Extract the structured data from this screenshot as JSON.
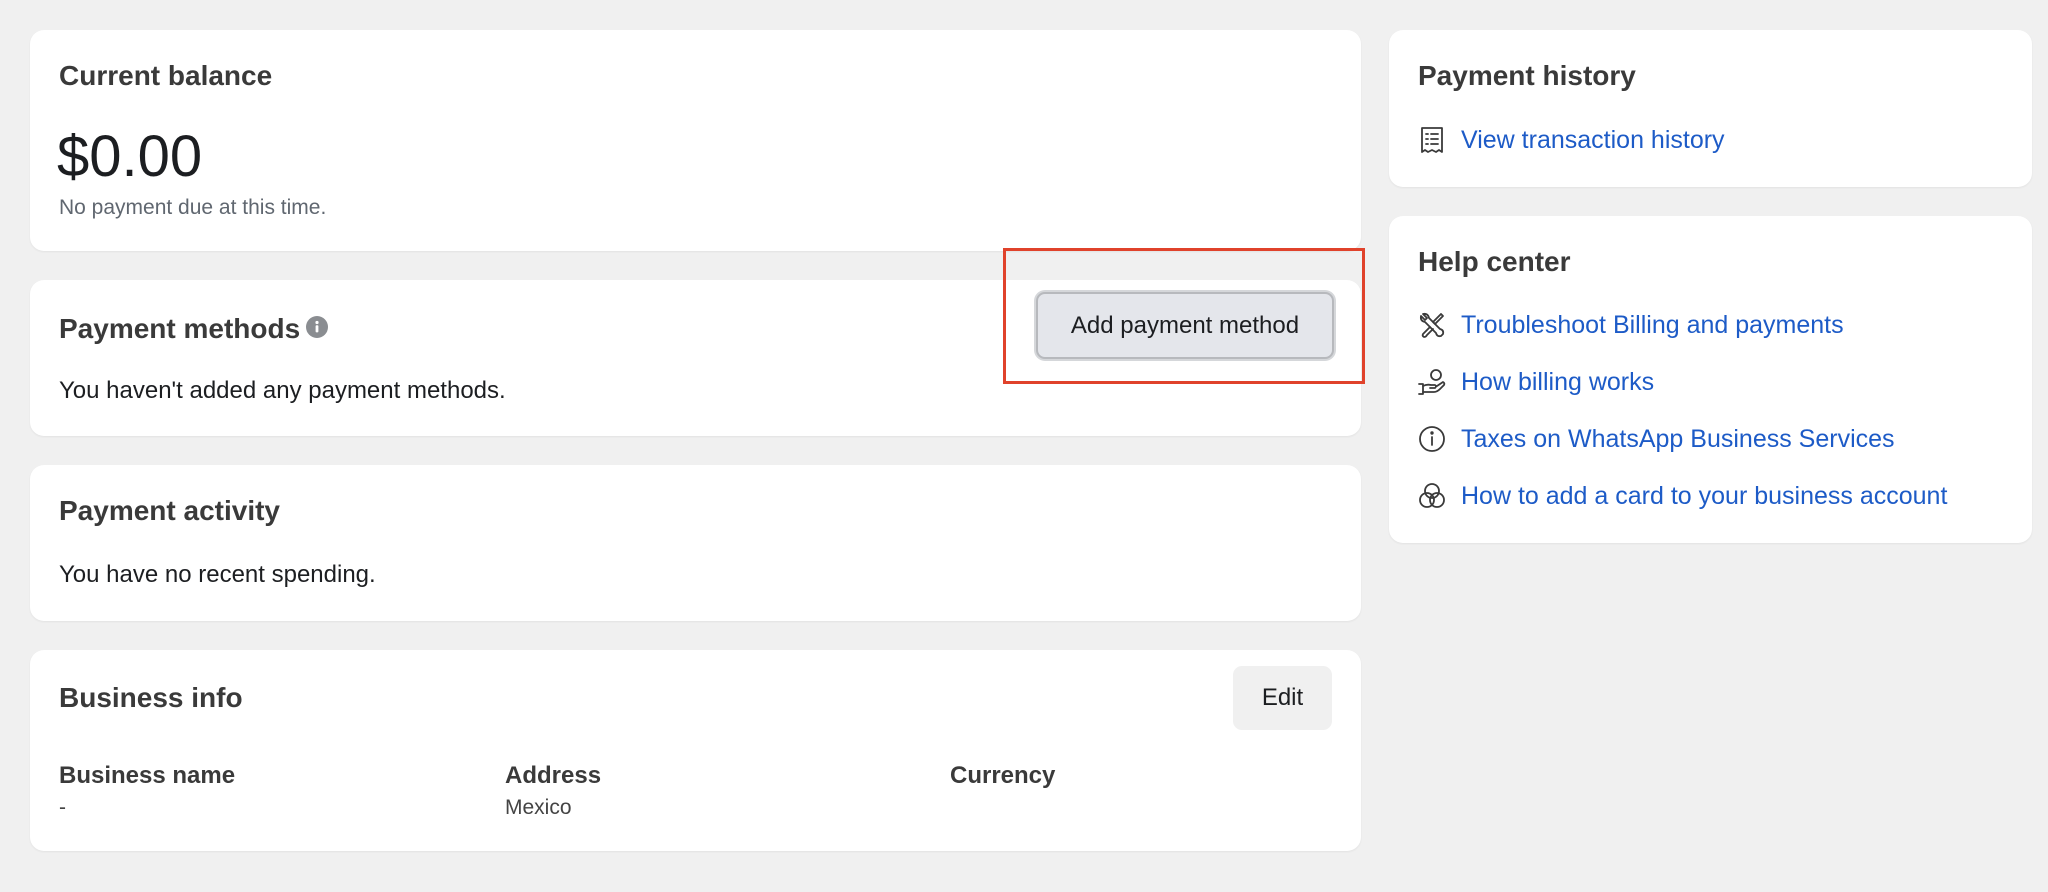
{
  "current_balance": {
    "title": "Current balance",
    "amount": "$0.00",
    "note": "No payment due at this time."
  },
  "payment_methods": {
    "title": "Payment methods",
    "info_icon": "info-icon",
    "add_button_label": "Add payment method",
    "empty_text": "You haven't added any payment methods."
  },
  "payment_activity": {
    "title": "Payment activity",
    "empty_text": "You have no recent spending."
  },
  "business_info": {
    "title": "Business info",
    "edit_label": "Edit",
    "fields": [
      {
        "label": "Business name",
        "value": "-"
      },
      {
        "label": "Address",
        "value": "Mexico"
      },
      {
        "label": "Currency",
        "value": ""
      }
    ]
  },
  "payment_history": {
    "title": "Payment history",
    "link": {
      "icon": "receipt-icon",
      "label": "View transaction history"
    }
  },
  "help_center": {
    "title": "Help center",
    "links": [
      {
        "icon": "tools-icon",
        "label": "Troubleshoot Billing and payments"
      },
      {
        "icon": "hand-coin-icon",
        "label": "How billing works"
      },
      {
        "icon": "info-circle-icon",
        "label": "Taxes on WhatsApp Business Services"
      },
      {
        "icon": "overlapping-circles-icon",
        "label": "How to add a card to your business account"
      }
    ]
  },
  "colors": {
    "page_background": "#f0f0f0",
    "card_background": "#ffffff",
    "link": "#1d5bc7",
    "highlight_box": "#e0422b"
  }
}
